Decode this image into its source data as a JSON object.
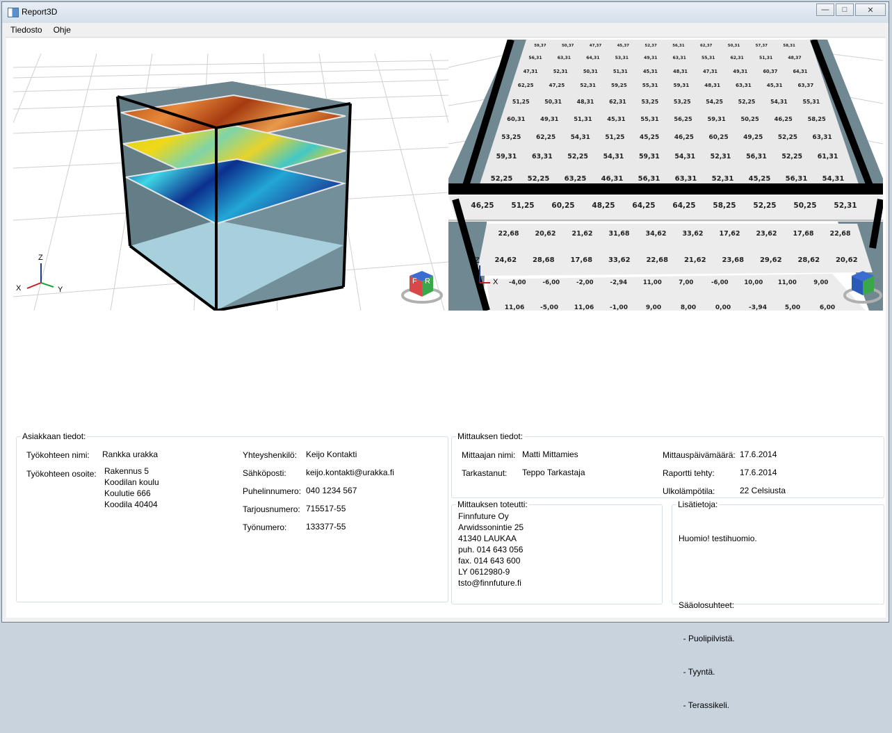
{
  "window": {
    "title": "Report3D",
    "minimize": "—",
    "maximize": "□",
    "close": "✕"
  },
  "menu": [
    "Tiedosto",
    "Ohje"
  ],
  "viewport_left": {
    "axis_labels": {
      "z": "Z",
      "x": "X",
      "y": "Y"
    },
    "cube_faces": {
      "f": "F",
      "r": "R"
    }
  },
  "viewport_right": {
    "axis_labels": {
      "z": "Z",
      "x": "X"
    },
    "upper_rows": [
      [
        "59,37",
        "50,37",
        "47,37",
        "45,37",
        "52,37",
        "56,31",
        "62,37",
        "50,31",
        "57,37",
        "58,31"
      ],
      [
        "56,31",
        "63,31",
        "64,31",
        "53,31",
        "49,31",
        "63,31",
        "55,31",
        "62,31",
        "51,31",
        "48,37"
      ],
      [
        "47,31",
        "52,31",
        "50,31",
        "51,31",
        "45,31",
        "48,31",
        "47,31",
        "49,31",
        "60,37",
        "64,31"
      ],
      [
        "62,25",
        "47,25",
        "52,31",
        "59,25",
        "55,31",
        "59,31",
        "48,31",
        "63,31",
        "45,31",
        "63,37"
      ],
      [
        "51,25",
        "50,31",
        "48,31",
        "62,31",
        "53,25",
        "53,25",
        "54,25",
        "52,25",
        "54,31",
        "55,31"
      ],
      [
        "60,31",
        "49,31",
        "51,31",
        "45,31",
        "55,31",
        "56,25",
        "59,31",
        "50,25",
        "46,25",
        "58,25"
      ],
      [
        "53,25",
        "62,25",
        "54,31",
        "51,25",
        "45,25",
        "46,25",
        "60,25",
        "49,25",
        "52,25",
        "63,31"
      ],
      [
        "59,31",
        "63,31",
        "52,25",
        "54,31",
        "59,31",
        "54,31",
        "52,31",
        "56,31",
        "52,25",
        "61,31"
      ],
      [
        "52,25",
        "52,25",
        "63,25",
        "46,31",
        "56,31",
        "63,31",
        "52,31",
        "45,25",
        "56,31",
        "54,31"
      ]
    ],
    "band_row": [
      "46,25",
      "51,25",
      "60,25",
      "48,25",
      "64,25",
      "64,25",
      "58,25",
      "52,25",
      "50,25",
      "52,31"
    ],
    "middle_rows": [
      [
        "22,68",
        "20,62",
        "21,62",
        "31,68",
        "34,62",
        "33,62",
        "17,62",
        "23,62",
        "17,68",
        "22,68"
      ],
      [
        "24,62",
        "28,68",
        "17,68",
        "33,62",
        "22,68",
        "21,62",
        "23,68",
        "29,62",
        "28,62",
        "20,62"
      ]
    ],
    "lower_rows": [
      [
        "-4,00",
        "-6,00",
        "-2,00",
        "-2,94",
        "11,00",
        "7,00",
        "-6,00",
        "10,00",
        "11,00",
        "9,00"
      ],
      [
        "11,06",
        "-5,00",
        "11,06",
        "-1,00",
        "9,00",
        "8,00",
        "0,00",
        "-3,94",
        "5,00",
        "6,00"
      ]
    ]
  },
  "asiakas": {
    "legend": "Asiakkaan tiedot:",
    "tyokohde_nimi_label": "Työkohteen nimi:",
    "tyokohde_nimi": "Rankka urakka",
    "tyokohde_osoite_label": "Työkohteen osoite:",
    "osoite": [
      "Rakennus 5",
      "Koodilan koulu",
      "Koulutie 666",
      "Koodila 40404"
    ],
    "yhteyshenkilo_label": "Yhteyshenkilö:",
    "yhteyshenkilo": "Keijo Kontakti",
    "sahkoposti_label": "Sähköposti:",
    "sahkoposti": "keijo.kontakti@urakka.fi",
    "puhelin_label": "Puhelinnumero:",
    "puhelin": "040 1234 567",
    "tarjous_label": "Tarjousnumero:",
    "tarjous": "715517-55",
    "tyonumero_label": "Työnumero:",
    "tyonumero": "133377-55"
  },
  "mittaus": {
    "legend": "Mittauksen tiedot:",
    "mittaaja_label": "Mittaajan nimi:",
    "mittaaja": "Matti Mittamies",
    "tarkastanut_label": "Tarkastanut:",
    "tarkastanut": "Teppo Tarkastaja",
    "paiva_label": "Mittauspäivämäärä:",
    "paiva": "17.6.2014",
    "raportti_label": "Raportti tehty:",
    "raportti": "17.6.2014",
    "ulkolampo_label": "Ulkolämpötila:",
    "ulkolampo": "22 Celsiusta"
  },
  "toteutti": {
    "legend": "Mittauksen toteutti:",
    "lines": [
      "Finnfuture Oy",
      "Arwidssonintie 25",
      "41340 LAUKAA",
      "puh. 014 643 056",
      "fax. 014 643 600",
      "LY 0612980-9",
      "tsto@finnfuture.fi"
    ]
  },
  "lisatietoja": {
    "legend": "Lisätietoja:",
    "lines": [
      "Huomio! testihuomio.",
      "",
      "Sääolosuhteet:",
      "  - Puolipilvistä.",
      "  - Tyyntä.",
      "  - Terassikeli."
    ]
  },
  "colors": {
    "cube_side": "#5f7a84",
    "cube_bottom": "#a7cfdc",
    "grid_line": "#c8c8c8"
  }
}
